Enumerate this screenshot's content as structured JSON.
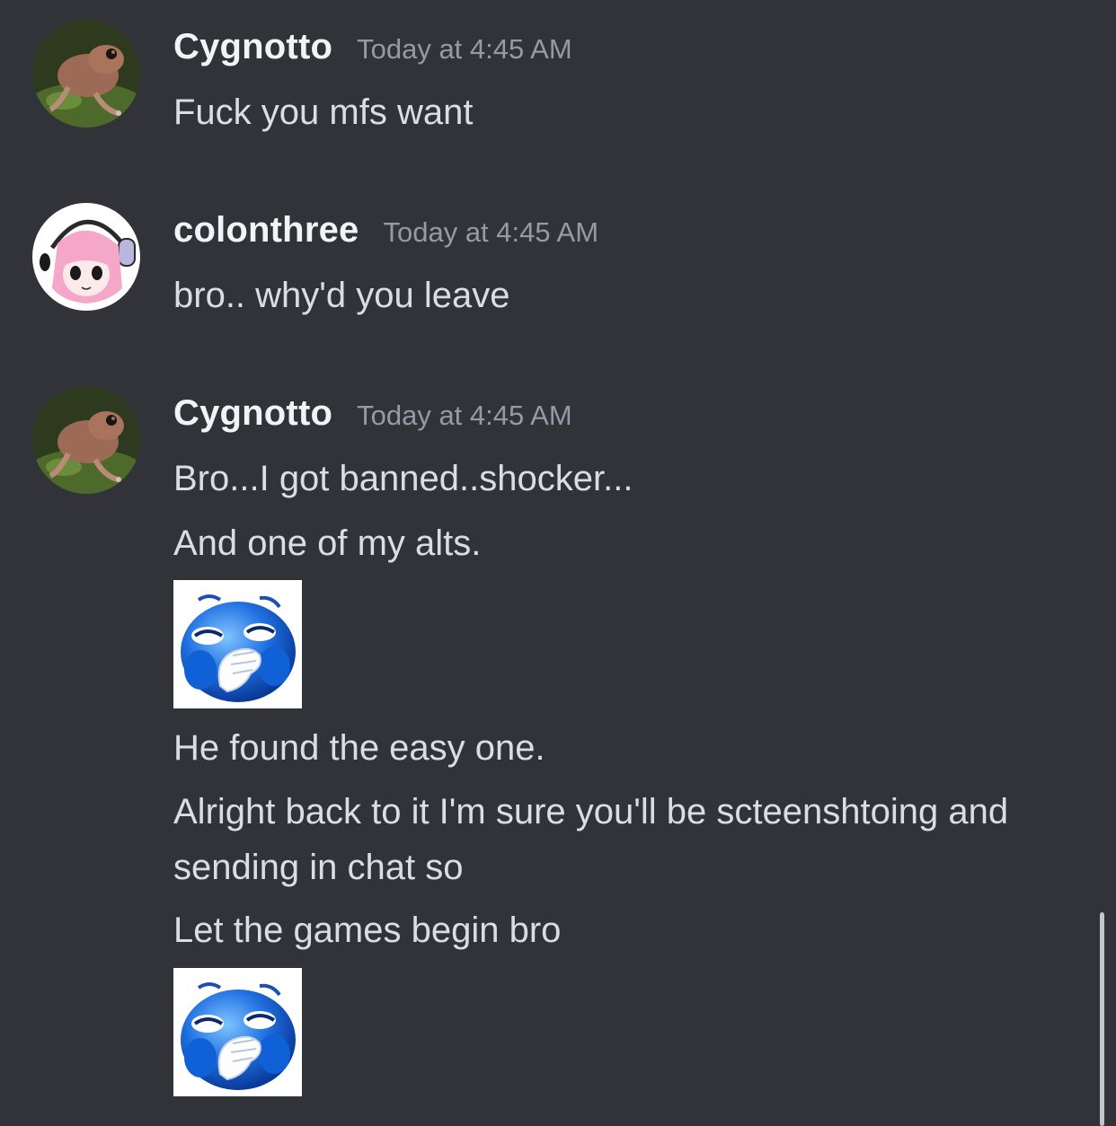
{
  "messages": [
    {
      "username": "Cygnotto",
      "timestamp": "Today at 4:45 AM",
      "avatar": "frog-avatar",
      "lines": [
        "Fuck you mfs want"
      ]
    },
    {
      "username": "colonthree",
      "timestamp": "Today at 4:45 AM",
      "avatar": "anime-girl-avatar",
      "lines": [
        "bro.. why'd you leave"
      ]
    },
    {
      "username": "Cygnotto",
      "timestamp": "Today at 4:45 AM",
      "avatar": "frog-avatar",
      "lines": [
        "Bro...I got banned..shocker...",
        "And one of my alts.",
        "He found the easy one.",
        "Alright back to it I'm sure you'll be scteenshtoing and sending in chat so",
        "Let the games begin bro"
      ],
      "attachments": [
        "laughing-blue-emoji",
        "laughing-blue-emoji"
      ]
    }
  ],
  "colors": {
    "background": "#313338",
    "username": "#f2f3f5",
    "timestamp": "#949ba4",
    "message_text": "#dbdee1"
  }
}
